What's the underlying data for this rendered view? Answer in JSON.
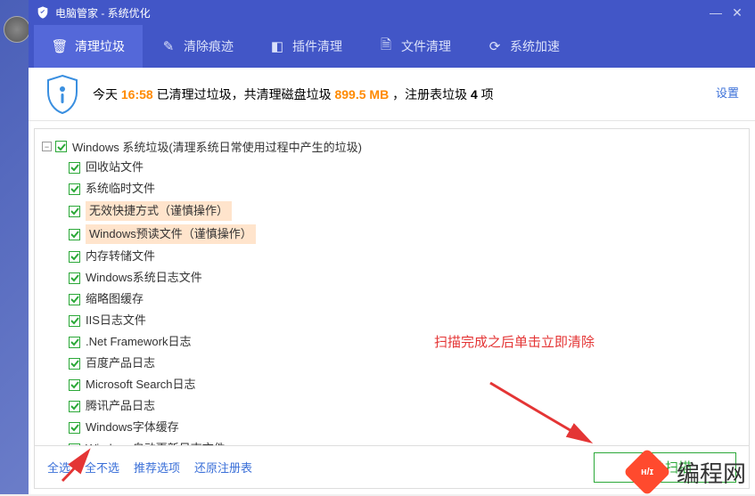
{
  "window": {
    "title": "电脑管家 - 系统优化"
  },
  "tabs": [
    {
      "icon": "🗑",
      "label": "清理垃圾"
    },
    {
      "icon": "✎",
      "label": "清除痕迹"
    },
    {
      "icon": "🧩",
      "label": "插件清理"
    },
    {
      "icon": "📄",
      "label": "文件清理"
    },
    {
      "icon": "⟳",
      "label": "系统加速"
    }
  ],
  "info": {
    "prefix": "今天 ",
    "time": "16:58",
    "mid1": " 已清理过垃圾，共清理磁盘垃圾 ",
    "size": "899.5 MB",
    "mid2": " ，注册表垃圾 ",
    "count": "4",
    "suffix": " 项"
  },
  "settings_label": "设置",
  "tree": {
    "root": "Windows 系统垃圾(清理系统日常使用过程中产生的垃圾)",
    "items": [
      {
        "label": "回收站文件",
        "hl": false
      },
      {
        "label": "系统临时文件",
        "hl": false
      },
      {
        "label": "无效快捷方式（谨慎操作）",
        "hl": true
      },
      {
        "label": "Windows预读文件（谨慎操作）",
        "hl": true
      },
      {
        "label": "内存转储文件",
        "hl": false
      },
      {
        "label": "Windows系统日志文件",
        "hl": false
      },
      {
        "label": "缩略图缓存",
        "hl": false
      },
      {
        "label": "IIS日志文件",
        "hl": false
      },
      {
        "label": ".Net Framework日志",
        "hl": false
      },
      {
        "label": "百度产品日志",
        "hl": false
      },
      {
        "label": "Microsoft Search日志",
        "hl": false
      },
      {
        "label": "腾讯产品日志",
        "hl": false
      },
      {
        "label": "Windows字体缓存",
        "hl": false
      },
      {
        "label": "Windows自动更新日志文件",
        "hl": false
      }
    ]
  },
  "footer": {
    "select_all": "全选",
    "select_none": "全不选",
    "recommended": "推荐选项",
    "ignore_reg": "还原注册表",
    "scan_btn": "开始扫描"
  },
  "annotation_text": "扫描完成之后单击立即清除",
  "watermark_text": "编程网"
}
